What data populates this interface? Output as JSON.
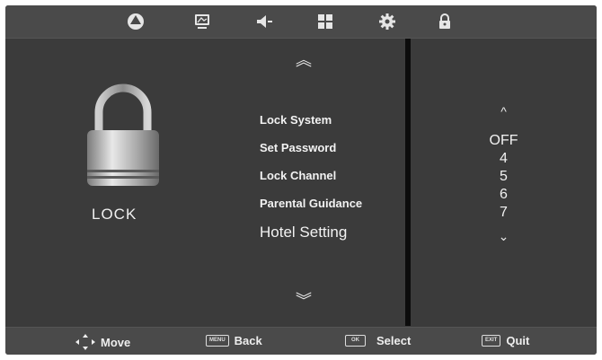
{
  "tabs": [
    {
      "icon": "picture-icon"
    },
    {
      "icon": "screen-icon"
    },
    {
      "icon": "sound-icon"
    },
    {
      "icon": "function-icon"
    },
    {
      "icon": "settings-icon"
    },
    {
      "icon": "lock-icon"
    }
  ],
  "left_panel": {
    "label": "LOCK",
    "icon": "padlock-icon"
  },
  "menu": {
    "up_arrow": "︽",
    "down_arrow": "︾",
    "items": [
      {
        "label": "Lock System"
      },
      {
        "label": "Set Password"
      },
      {
        "label": "Lock Channel"
      },
      {
        "label": "Parental Guidance"
      },
      {
        "label": "Hotel Setting"
      }
    ]
  },
  "options": {
    "up": "^",
    "down": "⌄",
    "values": [
      "OFF",
      "4",
      "5",
      "6",
      "7"
    ]
  },
  "footer": {
    "move": "Move",
    "back_key": "MENU",
    "back": "Back",
    "select_key": "OK",
    "select": "Select",
    "quit_key": "EXIT",
    "quit": "Quit"
  }
}
